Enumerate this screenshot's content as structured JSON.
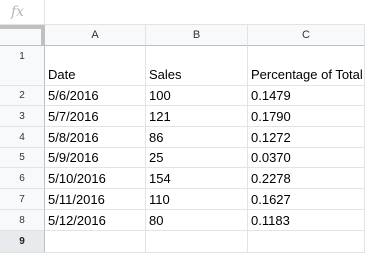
{
  "formula_bar": {
    "icon": "fx-icon",
    "label": "fx",
    "value": ""
  },
  "columns": [
    "A",
    "B",
    "C"
  ],
  "rows": [
    {
      "num": "1",
      "cells": [
        "Date",
        "Sales",
        "Percentage of Total"
      ]
    },
    {
      "num": "2",
      "cells": [
        "5/6/2016",
        "100",
        "0.1479"
      ]
    },
    {
      "num": "3",
      "cells": [
        "5/7/2016",
        "121",
        "0.1790"
      ]
    },
    {
      "num": "4",
      "cells": [
        "5/8/2016",
        "86",
        "0.1272"
      ]
    },
    {
      "num": "5",
      "cells": [
        "5/9/2016",
        "25",
        "0.0370"
      ]
    },
    {
      "num": "6",
      "cells": [
        "5/10/2016",
        "154",
        "0.2278"
      ]
    },
    {
      "num": "7",
      "cells": [
        "5/11/2016",
        "110",
        "0.1627"
      ]
    },
    {
      "num": "8",
      "cells": [
        "5/12/2016",
        "80",
        "0.1183"
      ]
    },
    {
      "num": "9",
      "cells": [
        "",
        "",
        ""
      ]
    }
  ],
  "selected_row": "9",
  "colors": {
    "header_bg": "#f8f9fa",
    "gridline": "#e2e3e3",
    "header_border": "#c0c0c0"
  }
}
